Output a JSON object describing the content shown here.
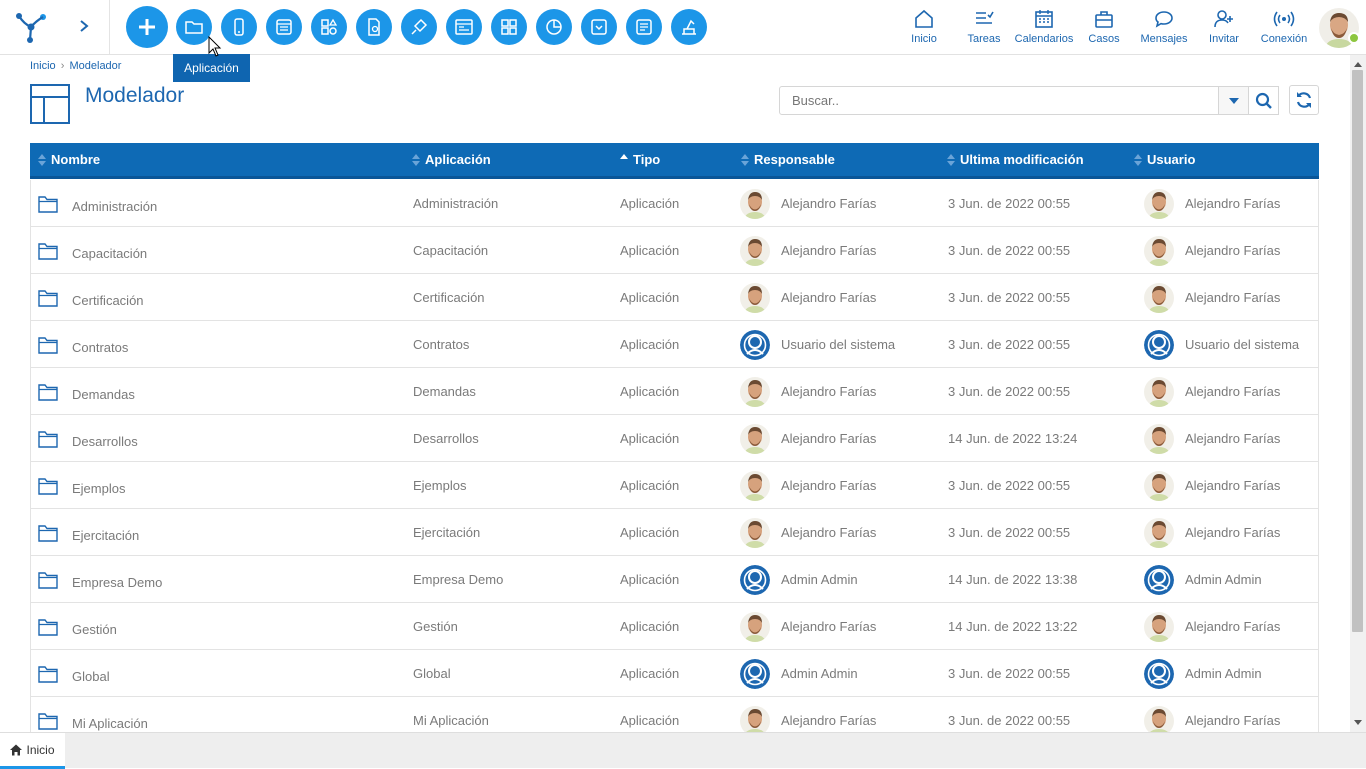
{
  "toolbar": {
    "tooltip": "Aplicación",
    "buttons": [
      {
        "icon": "plus-icon"
      },
      {
        "icon": "folder-icon"
      },
      {
        "icon": "mobile-icon"
      },
      {
        "icon": "form-icon"
      },
      {
        "icon": "shapes-icon"
      },
      {
        "icon": "document-gear-icon"
      },
      {
        "icon": "plug-icon"
      },
      {
        "icon": "window-icon"
      },
      {
        "icon": "grid-icon"
      },
      {
        "icon": "pie-chart-icon"
      },
      {
        "icon": "dropdown-box-icon"
      },
      {
        "icon": "list-icon"
      },
      {
        "icon": "worker-icon"
      }
    ]
  },
  "nav": {
    "inicio": "Inicio",
    "tareas": "Tareas",
    "calendarios": "Calendarios",
    "casos": "Casos",
    "mensajes": "Mensajes",
    "invitar": "Invitar",
    "conexion": "Conexión"
  },
  "breadcrumb": {
    "home": "Inicio",
    "separator": "›",
    "current": "Modelador"
  },
  "page": {
    "title": "Modelador"
  },
  "search": {
    "placeholder": "Buscar.."
  },
  "table": {
    "columns": [
      "Nombre",
      "Aplicación",
      "Tipo",
      "Responsable",
      "Ultima modificación",
      "Usuario"
    ],
    "rows": [
      {
        "nombre": "Administración",
        "aplicacion": "Administración",
        "tipo": "Aplicación",
        "responsable": "Alejandro Farías",
        "resp_avatar": "photo",
        "modificacion": "3 Jun. de 2022 00:55",
        "usuario": "Alejandro Farías",
        "user_avatar": "photo"
      },
      {
        "nombre": "Capacitación",
        "aplicacion": "Capacitación",
        "tipo": "Aplicación",
        "responsable": "Alejandro Farías",
        "resp_avatar": "photo",
        "modificacion": "3 Jun. de 2022 00:55",
        "usuario": "Alejandro Farías",
        "user_avatar": "photo"
      },
      {
        "nombre": "Certificación",
        "aplicacion": "Certificación",
        "tipo": "Aplicación",
        "responsable": "Alejandro Farías",
        "resp_avatar": "photo",
        "modificacion": "3 Jun. de 2022 00:55",
        "usuario": "Alejandro Farías",
        "user_avatar": "photo"
      },
      {
        "nombre": "Contratos",
        "aplicacion": "Contratos",
        "tipo": "Aplicación",
        "responsable": "Usuario del sistema",
        "resp_avatar": "system",
        "modificacion": "3 Jun. de 2022 00:55",
        "usuario": "Usuario del sistema",
        "user_avatar": "system"
      },
      {
        "nombre": "Demandas",
        "aplicacion": "Demandas",
        "tipo": "Aplicación",
        "responsable": "Alejandro Farías",
        "resp_avatar": "photo",
        "modificacion": "3 Jun. de 2022 00:55",
        "usuario": "Alejandro Farías",
        "user_avatar": "photo"
      },
      {
        "nombre": "Desarrollos",
        "aplicacion": "Desarrollos",
        "tipo": "Aplicación",
        "responsable": "Alejandro Farías",
        "resp_avatar": "photo",
        "modificacion": "14 Jun. de 2022 13:24",
        "usuario": "Alejandro Farías",
        "user_avatar": "photo"
      },
      {
        "nombre": "Ejemplos",
        "aplicacion": "Ejemplos",
        "tipo": "Aplicación",
        "responsable": "Alejandro Farías",
        "resp_avatar": "photo",
        "modificacion": "3 Jun. de 2022 00:55",
        "usuario": "Alejandro Farías",
        "user_avatar": "photo"
      },
      {
        "nombre": "Ejercitación",
        "aplicacion": "Ejercitación",
        "tipo": "Aplicación",
        "responsable": "Alejandro Farías",
        "resp_avatar": "photo",
        "modificacion": "3 Jun. de 2022 00:55",
        "usuario": "Alejandro Farías",
        "user_avatar": "photo"
      },
      {
        "nombre": "Empresa Demo",
        "aplicacion": "Empresa Demo",
        "tipo": "Aplicación",
        "responsable": "Admin Admin",
        "resp_avatar": "system",
        "modificacion": "14 Jun. de 2022 13:38",
        "usuario": "Admin Admin",
        "user_avatar": "system"
      },
      {
        "nombre": "Gestión",
        "aplicacion": "Gestión",
        "tipo": "Aplicación",
        "responsable": "Alejandro Farías",
        "resp_avatar": "photo",
        "modificacion": "14 Jun. de 2022 13:22",
        "usuario": "Alejandro Farías",
        "user_avatar": "photo"
      },
      {
        "nombre": "Global",
        "aplicacion": "Global",
        "tipo": "Aplicación",
        "responsable": "Admin Admin",
        "resp_avatar": "system",
        "modificacion": "3 Jun. de 2022 00:55",
        "usuario": "Admin Admin",
        "user_avatar": "system"
      },
      {
        "nombre": "Mi Aplicación",
        "aplicacion": "Mi Aplicación",
        "tipo": "Aplicación",
        "responsable": "Alejandro Farías",
        "resp_avatar": "photo",
        "modificacion": "3 Jun. de 2022 00:55",
        "usuario": "Alejandro Farías",
        "user_avatar": "photo"
      }
    ]
  },
  "bottom_tab": {
    "label": "Inicio"
  },
  "colors": {
    "accent": "#1c96e8",
    "header": "#0e6ab5",
    "title": "#1d67b0"
  }
}
